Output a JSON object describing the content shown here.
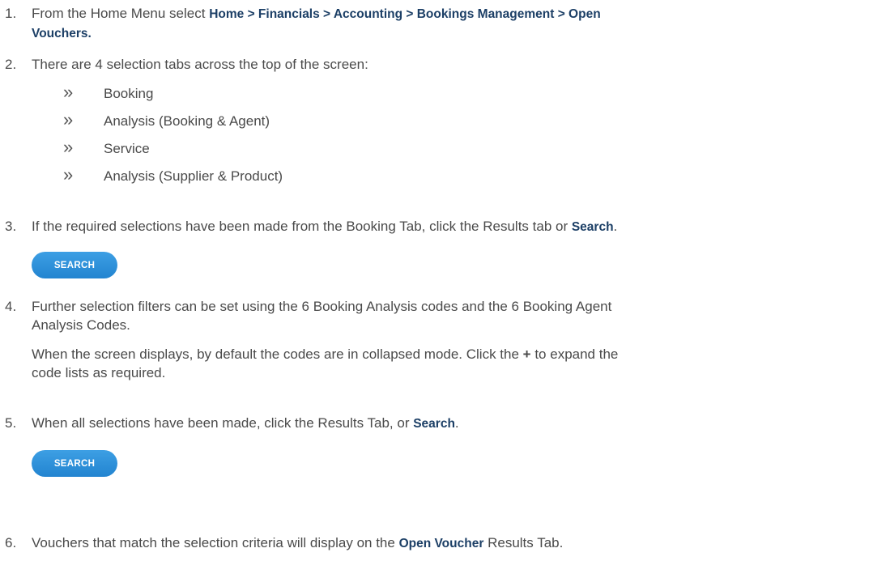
{
  "steps": [
    {
      "num": "1.",
      "prefix": "From the Home Menu select ",
      "path": "Home > Financials > Accounting > Bookings Management > Open",
      "path2": "Vouchers."
    },
    {
      "num": "2.",
      "text": "There are 4 selection tabs across the top of the screen:"
    },
    {
      "num": "3.",
      "prefix": "If the required selections have been made from the Booking Tab, click the Results tab or ",
      "ui": "Search",
      "suffix": "."
    },
    {
      "num": "4.",
      "line1": "Further selection filters can be set using the 6 Booking Analysis codes and the 6 Booking Agent",
      "line2": "Analysis Codes.",
      "para2_prefix": "When the screen displays, by default the codes are in collapsed mode. Click the ",
      "plus": "+",
      "para2_suffix": " to expand the",
      "para2_line2": "code lists as required."
    },
    {
      "num": "5.",
      "prefix": "When all selections have been made, click the Results Tab, or ",
      "ui": "Search",
      "suffix": "."
    },
    {
      "num": "6.",
      "prefix": "Vouchers that match the selection criteria will display on the ",
      "ui": "Open Voucher",
      "suffix": " Results Tab."
    }
  ],
  "tabs": [
    "Booking",
    "Analysis (Booking & Agent)",
    "Service",
    "Analysis (Supplier & Product)"
  ],
  "bullet_glyph": "»",
  "search_button": "SEARCH"
}
